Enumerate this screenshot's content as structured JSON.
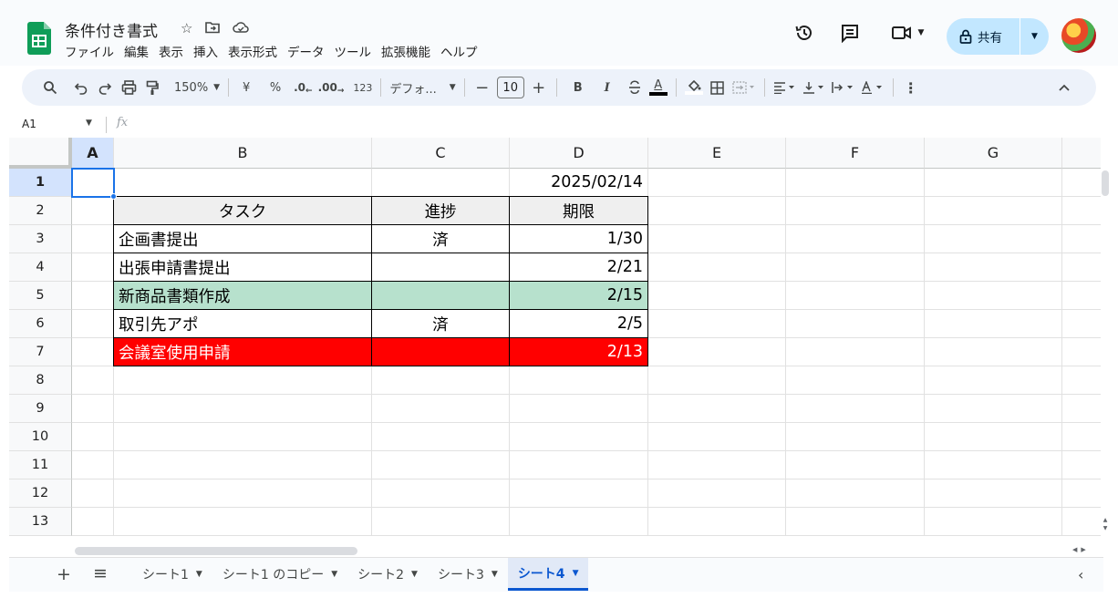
{
  "doc": {
    "title": "条件付き書式"
  },
  "menu": [
    "ファイル",
    "編集",
    "表示",
    "挿入",
    "表示形式",
    "データ",
    "ツール",
    "拡張機能",
    "ヘルプ"
  ],
  "share": {
    "label": "共有"
  },
  "toolbar": {
    "zoom": "150%",
    "currency": "¥",
    "percent": "%",
    "dec_decrease": ".0",
    "dec_increase": ".00",
    "number_format": "123",
    "font": "デフォ...",
    "font_size": "10",
    "bold": "B",
    "italic": "I",
    "text_color": "A"
  },
  "formula_bar": {
    "name_box": "A1",
    "fx": "fx"
  },
  "grid": {
    "columns": [
      "A",
      "B",
      "C",
      "D",
      "E",
      "F",
      "G"
    ],
    "rows": [
      "1",
      "2",
      "3",
      "4",
      "5",
      "6",
      "7",
      "8",
      "9",
      "10",
      "11",
      "12",
      "13"
    ],
    "selected_column": "A",
    "selected_row": "1",
    "active_cell": "A1"
  },
  "table": {
    "date": "2025/02/14",
    "headers": [
      "タスク",
      "進捗",
      "期限"
    ],
    "rows": [
      {
        "task": "企画書提出",
        "status": "済",
        "due": "1/30",
        "style": "plain"
      },
      {
        "task": "出張申請書提出",
        "status": "",
        "due": "2/21",
        "style": "plain"
      },
      {
        "task": "新商品書類作成",
        "status": "",
        "due": "2/15",
        "style": "green"
      },
      {
        "task": "取引先アポ",
        "status": "済",
        "due": "2/5",
        "style": "plain"
      },
      {
        "task": "会議室使用申請",
        "status": "",
        "due": "2/13",
        "style": "red"
      }
    ],
    "colors": {
      "header_fill": "#efefef",
      "green_fill": "#b7e1cd",
      "red_fill": "#ff0000",
      "red_text": "#ffffff"
    }
  },
  "sheets": [
    {
      "name": "シート1",
      "active": false
    },
    {
      "name": "シート1 のコピー",
      "active": false
    },
    {
      "name": "シート2",
      "active": false
    },
    {
      "name": "シート3",
      "active": false
    },
    {
      "name": "シート4",
      "active": true
    }
  ],
  "icons": [
    "sheets-logo-icon",
    "star-icon",
    "move-folder-icon",
    "cloud-saved-icon",
    "history-icon",
    "comment-icon",
    "meet-icon",
    "lock-icon",
    "search-icon",
    "undo-icon",
    "redo-icon",
    "print-icon",
    "paint-format-icon",
    "strikethrough-icon",
    "fill-color-icon",
    "borders-icon",
    "merge-icon",
    "align-icon",
    "valign-icon",
    "wrap-icon",
    "rotate-icon",
    "more-icon",
    "collapse-icon",
    "add-sheet-icon",
    "all-sheets-icon",
    "explore-icon"
  ]
}
